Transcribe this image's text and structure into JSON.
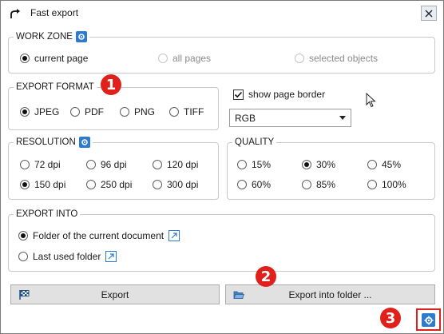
{
  "window": {
    "title": "Fast export",
    "title_icon": "export-arrow-icon",
    "close_icon": "close-icon"
  },
  "work_zone": {
    "legend": "WORK ZONE",
    "options": [
      {
        "label": "current page",
        "selected": true,
        "enabled": true
      },
      {
        "label": "all pages",
        "selected": false,
        "enabled": false
      },
      {
        "label": "selected objects",
        "selected": false,
        "enabled": false
      }
    ]
  },
  "export_format": {
    "legend": "EXPORT FORMAT",
    "options": [
      {
        "label": "JPEG",
        "selected": true
      },
      {
        "label": "PDF",
        "selected": false
      },
      {
        "label": "PNG",
        "selected": false
      },
      {
        "label": "TIFF",
        "selected": false
      }
    ]
  },
  "page_border": {
    "label": "show page border",
    "checked": true
  },
  "color_mode": {
    "value": "RGB"
  },
  "resolution": {
    "legend": "RESOLUTION",
    "options": [
      {
        "label": "72 dpi",
        "selected": false
      },
      {
        "label": "96 dpi",
        "selected": false
      },
      {
        "label": "120 dpi",
        "selected": false
      },
      {
        "label": "150 dpi",
        "selected": true
      },
      {
        "label": "250 dpi",
        "selected": false
      },
      {
        "label": "300 dpi",
        "selected": false
      }
    ]
  },
  "quality": {
    "legend": "QUALITY",
    "options": [
      {
        "label": "15%",
        "selected": false
      },
      {
        "label": "30%",
        "selected": true
      },
      {
        "label": "45%",
        "selected": false
      },
      {
        "label": "60%",
        "selected": false
      },
      {
        "label": "85%",
        "selected": false
      },
      {
        "label": "100%",
        "selected": false
      }
    ]
  },
  "export_into": {
    "legend": "EXPORT INTO",
    "options": [
      {
        "label": "Folder of the current document",
        "selected": true
      },
      {
        "label": "Last used folder",
        "selected": false
      }
    ]
  },
  "buttons": {
    "export": "Export",
    "export_into_folder": "Export into folder ..."
  },
  "callouts": {
    "one": "1",
    "two": "2",
    "three": "3"
  },
  "colors": {
    "accent": "#2c7bd1",
    "callout": "#e0201b"
  }
}
